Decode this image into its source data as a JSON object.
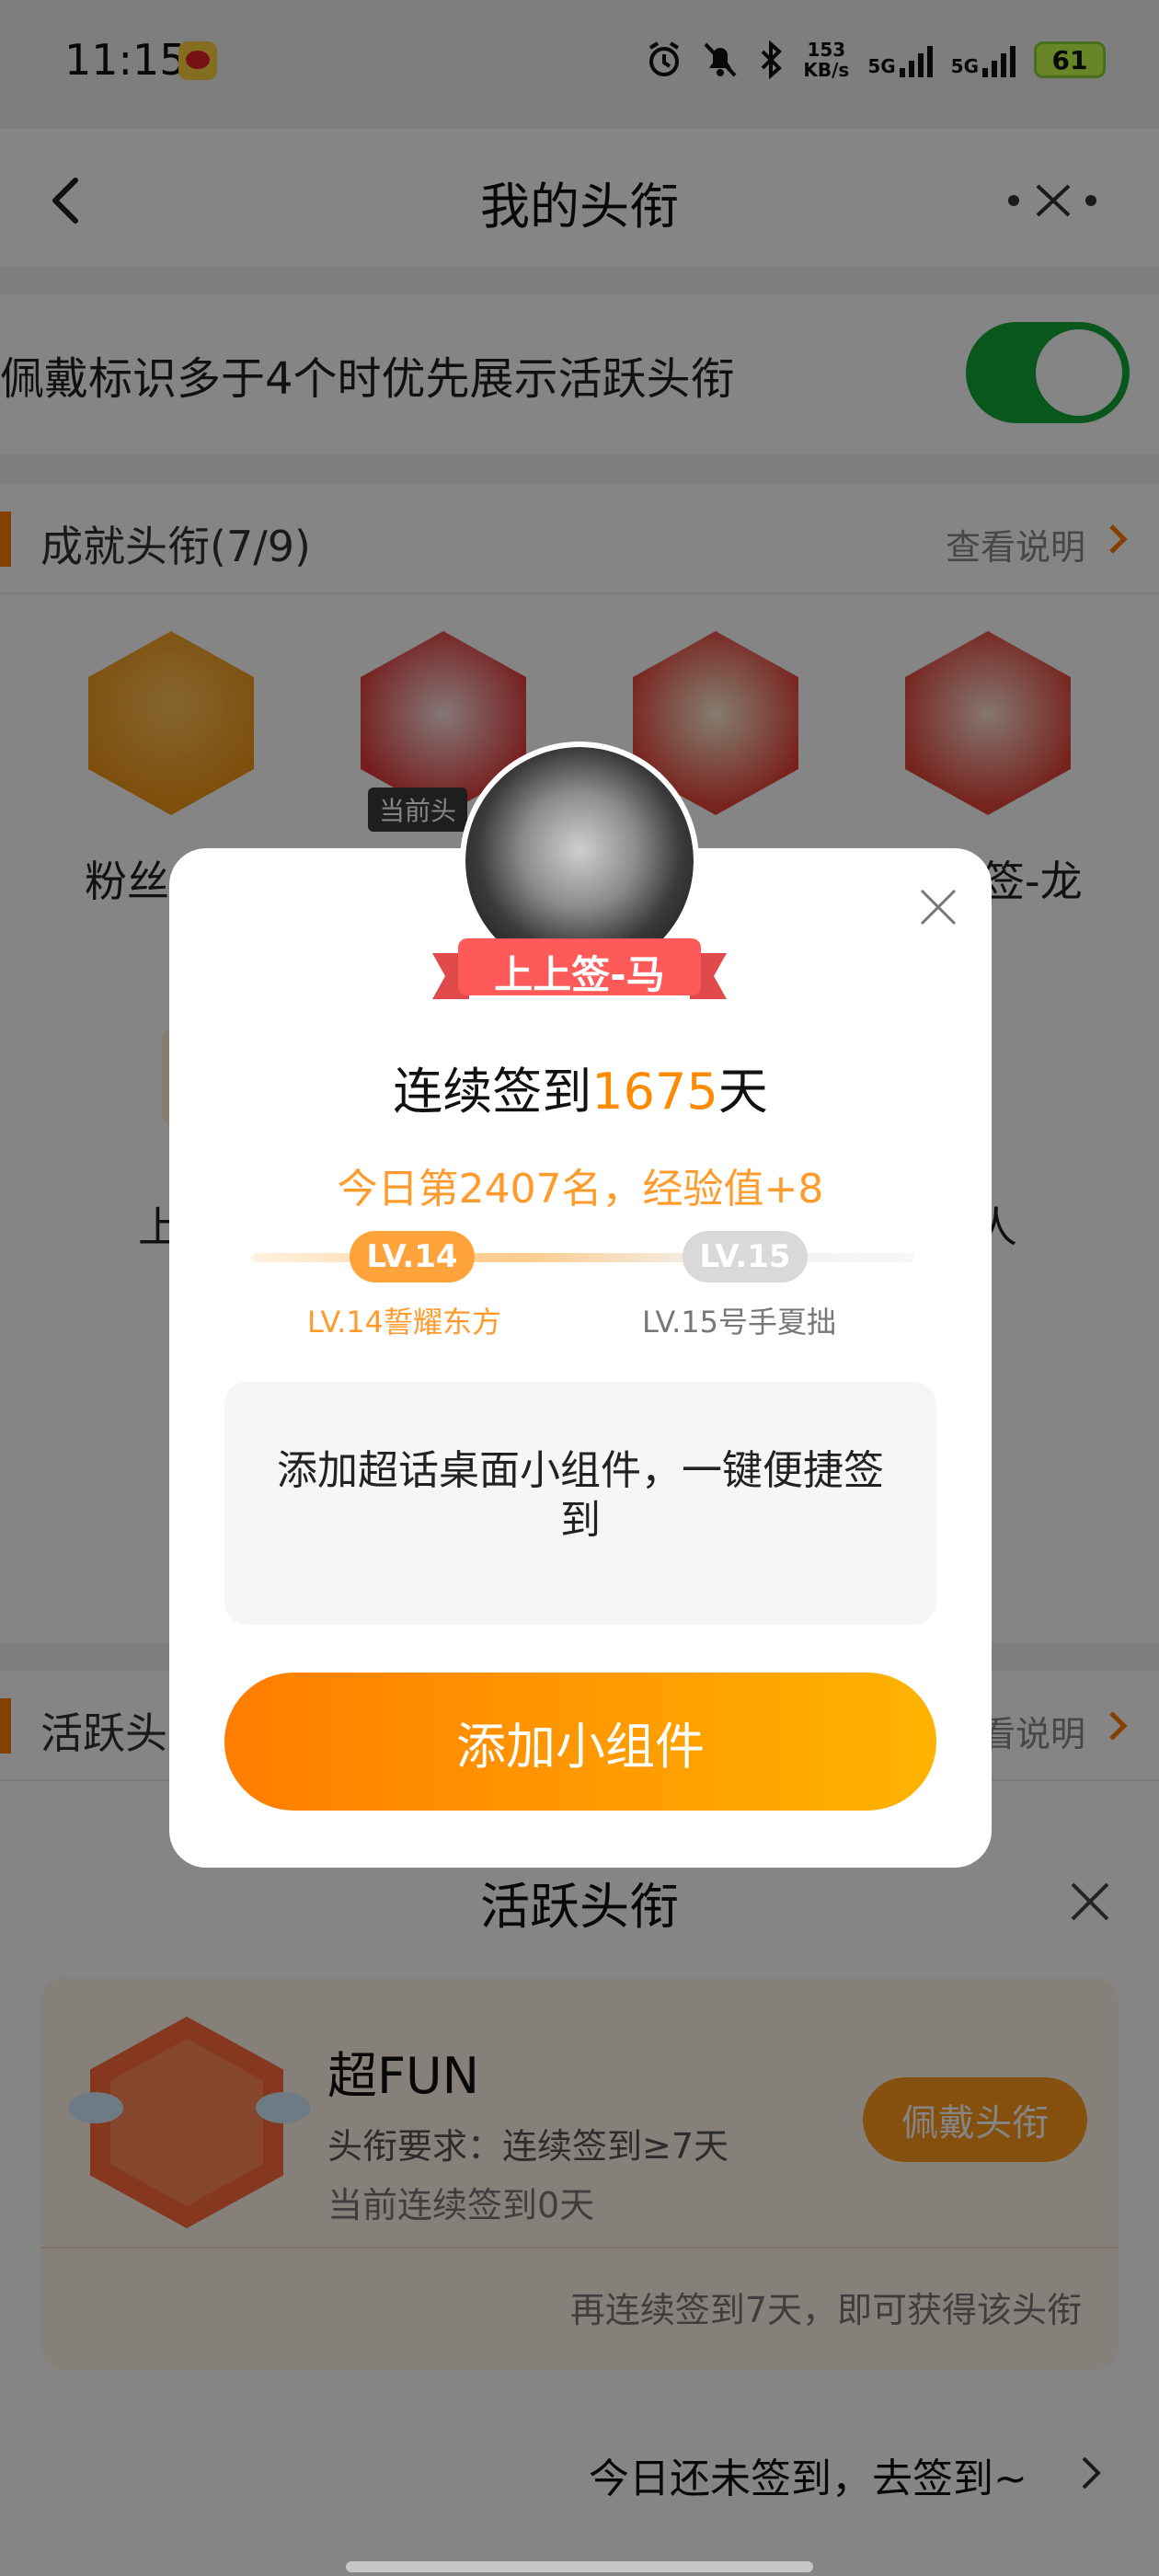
{
  "status_bar": {
    "time": "11:15",
    "net_speed": "153",
    "net_unit": "KB/s",
    "sig1": "5G",
    "sig2": "5G",
    "battery": "61"
  },
  "nav": {
    "title": "我的头衔"
  },
  "setting": {
    "label": "佩戴标识多于4个时优先展示活跃头衔",
    "enabled": true
  },
  "achievement_section": {
    "title": "成就头衔(7/9)",
    "more": "查看说明",
    "badges": [
      {
        "label": "粉丝",
        "icon": "crown-icon"
      },
      {
        "label": "",
        "icon": "horse-mascot-icon",
        "tag": "当前头"
      },
      {
        "label": "",
        "icon": "snake-mascot-icon"
      },
      {
        "label": "签-龙",
        "icon": "dragon-mascot-icon"
      }
    ],
    "under_left": "上",
    "under_right": "人"
  },
  "active_section": {
    "title": "活跃头",
    "more": "看说明"
  },
  "modal": {
    "ribbon": "上上签-马",
    "streak_prefix": "连续签到",
    "streak_days": "1675",
    "streak_suffix": "天",
    "rank": "今日第2407名，经验值+8",
    "level_current": "LV.14",
    "level_current_name": "LV.14誓耀东方",
    "level_next": "LV.15",
    "level_next_name": "LV.15号手夏拙",
    "tip": "添加超话桌面小组件，一键便捷签到",
    "add_button": "添加小组件"
  },
  "sheet": {
    "title": "活跃头衔",
    "card": {
      "name": "超FUN",
      "requirement": "头衔要求：连续签到≥7天",
      "current": "当前连续签到0天",
      "wear_button": "佩戴头衔",
      "hint": "再连续签到7天，即可获得该头衔"
    },
    "bottom_link": "今日还未签到，去签到~"
  },
  "colors": {
    "accent": "#ff8a00",
    "toggle_on": "#14a83a",
    "button_gradient_start": "#ff7d00",
    "button_gradient_end": "#ffb300"
  }
}
